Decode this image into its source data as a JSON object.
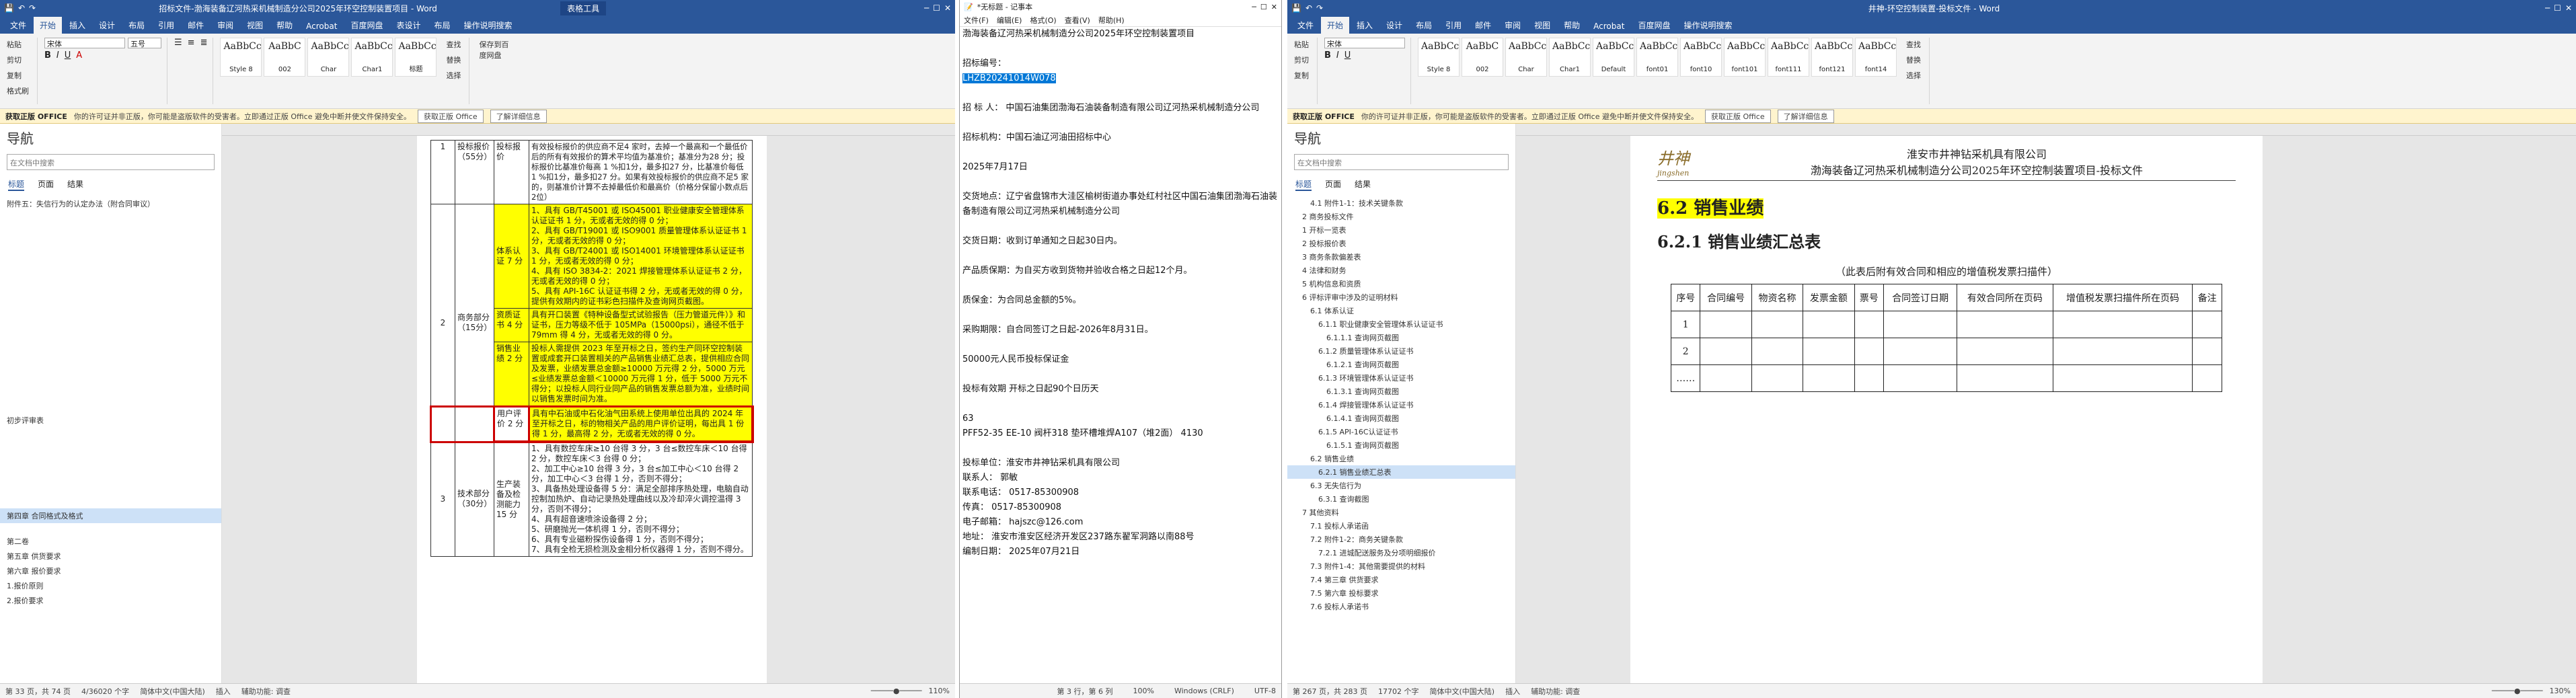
{
  "win1": {
    "title": "招标文件-渤海装备辽河热采机械制造分公司2025年环空控制装置项目 - Word",
    "ctx_tab": "表格工具",
    "share": "共享",
    "tabs": [
      "文件",
      "开始",
      "插入",
      "设计",
      "布局",
      "引用",
      "邮件",
      "审阅",
      "视图",
      "帮助",
      "Acrobat",
      "百度网盘",
      "表设计",
      "布局",
      "操作说明搜索"
    ],
    "ribbon": {
      "paste": "粘贴",
      "cut": "剪切",
      "copy": "复制",
      "format": "格式刷",
      "font": "宋体",
      "size": "五号",
      "find": "查找",
      "replace": "替换",
      "select": "选择",
      "save": "保存到百度网盘"
    },
    "styles": [
      {
        "s": "AaBbCcI",
        "n": "Style 8"
      },
      {
        "s": "AaBbC",
        "n": "002"
      },
      {
        "s": "AaBbCcI",
        "n": "Char"
      },
      {
        "s": "AaBbCcDc",
        "n": "Char1"
      },
      {
        "s": "AaBbCcDc",
        "n": "标题"
      }
    ],
    "msg": {
      "label": "获取正版 OFFICE",
      "text": "你的许可证并非正版，你可能是盗版软件的受害者。立即通过正版 Office 避免中断并使文件保持安全。",
      "b1": "获取正版 Office",
      "b2": "了解详细信息"
    },
    "nav": {
      "title": "导航",
      "search": "在文档中搜索",
      "tabs": [
        "标题",
        "页面",
        "结果"
      ],
      "items": [
        "附件五：失信行为的认定办法（附合同审议）",
        "初步评审表",
        "第四章 合同格式及格式",
        "第二卷",
        "第五章 供货要求",
        "第六章 报价要求",
        "1.报价原则",
        "2.报价要求"
      ]
    },
    "table": {
      "r1_no": "1",
      "r1_name": "投标报价（55分）",
      "r1_sub": "投标报价",
      "r1_text": "有效投标报价的供应商不足4 家时，去掉一个最高和一个最低价后的所有有效报价的算术平均值为基准价；基准分为28 分；投标报价比基准价每高 1 %扣1分，最多扣27 分，比基准价每低 1 %扣1分，最多扣27 分。如果有效投标报价的供应商不足5 家的，则基准价计算不去掉最低价和最高价（价格分保留小数点后2位）",
      "r2_no": "2",
      "r2_name": "商务部分（15分）",
      "sys_label": "体系认证 7 分",
      "sys_items": [
        "1、具有 GB/T45001 或 ISO45001 职业健康安全管理体系认证证书 1 分，无或者无效的得 0 分；",
        "2、具有 GB/T19001 或 ISO9001 质量管理体系认证证书 1 分，无或者无效的得 0 分；",
        "3、具有 GB/T24001 或 ISO14001 环境管理体系认证证书 1 分，无或者无效的得 0 分；",
        "4、具有 ISO 3834-2：2021 焊接管理体系认证证书 2 分，无或者无效的得 0 分；",
        "5、具有 API-16C 认证证书得 2 分，无或者无效的得 0 分，提供有效期内的证书彩色扫描件及查询网页截图。"
      ],
      "cert_label": "资质证书 4 分",
      "cert_text": "具有开口装置《特种设备型式试验报告（压力管道元件）》和证书，压力等级不低于 105MPa（15000psi），通径不低于 79mm 得 4 分，无或者无效的得 0 分。",
      "sales_label": "销售业绩 2 分",
      "sales_text": "投标人需提供 2023 年至开标之日，签约生产同环空控制装置或成套开口装置相关的产品销售业绩汇总表，提供相应合同及发票，业绩发票总金额≥10000 万元得 2 分，5000 万元≤业绩发票总金额＜10000 万元得 1 分，低于 5000 万元不得分；以投标人同行业同产品的销售发票总额为准，业绩时间以销售发票时间为准。",
      "user_label": "用户评价 2 分",
      "user_text": "具有中石油或中石化油气田系统上使用单位出具的 2024 年至开标之日，标的物相关产品的用户评价证明，每出具 1 份得 1 分，最高得 2 分，无或者无效的得 0 分。",
      "r3_no": "3",
      "r3_name": "技术部分（30分）",
      "r3_sub": "生产装备及检测能力 15 分",
      "r3_items": [
        "1、具有数控车床≥10 台得 3 分，3 台≤数控车床＜10 台得 2 分，数控车床＜3 台得 0 分；",
        "2、加工中心≥10 台得 3 分，3 台≤加工中心＜10 台得 2 分，加工中心＜3 台得 1 分，否则不得分；",
        "3、具备热处理设备得 5 分：满足全部排序热处理，电脑自动控制加热炉、自动记录热处理曲线以及冷却淬火调控温得 3 分，否则不得分；",
        "4、具有超音速喷涂设备得 2 分；",
        "5、研磨抛光一体机得 1 分，否则不得分；",
        "6、具有专业磁粉探伤设备得 1 分，否则不得分；",
        "7、具有全检无损检测及金相分析仪器得 1 分，否则不得分。"
      ]
    },
    "status": {
      "page": "第 33 页，共 74 页",
      "words": "4/36020 个字",
      "lang": "简体中文(中国大陆)",
      "ins": "插入",
      "access": "辅助功能: 调查",
      "zoom": "110%"
    }
  },
  "win2": {
    "title": "*无标题 - 记事本",
    "menu": [
      "文件(F)",
      "编辑(E)",
      "格式(O)",
      "查看(V)",
      "帮助(H)"
    ],
    "lines": [
      "渤海装备辽河热采机械制造分公司2025年环空控制装置项目",
      "",
      "招标编号：",
      "LHZB20241014W078",
      "",
      "招 标 人： 中国石油集团渤海石油装备制造有限公司辽河热采机械制造分公司",
      "",
      "招标机构：中国石油辽河油田招标中心",
      "",
      "2025年7月17日",
      "",
      "交货地点：辽宁省盘锦市大洼区榆树街道办事处红村社区中国石油集团渤海石油装备制造有限公司辽河热采机械制造分公司",
      "",
      "交货日期：收到订单通知之日起30日内。",
      "",
      "产品质保期：为自买方收到货物并验收合格之日起12个月。",
      "",
      "质保金：为合同总金额的5%。",
      "",
      "采购期限：自合同签订之日起-2026年8月31日。",
      "",
      "50000元人民币投标保证金",
      "",
      "投标有效期  开标之日起90个日历天",
      "",
      "63",
      "PFF52-35 EE-10 阀杆318 垫环槽堆焊A107（堆2面）  4130",
      "",
      "投标单位：淮安市井神钻采机具有限公司",
      "联系人：  郭敏",
      "联系电话：  0517-85300908",
      "传真：  0517-85300908",
      "电子邮箱：  hajszc@126.com",
      "地址：  淮安市淮安区经济开发区237路东翟军洞路以南88号",
      "编制日期：  2025年07月21日"
    ],
    "status": {
      "pos": "第 3 行，第 6 列",
      "zoom": "100%",
      "eol": "Windows (CRLF)",
      "enc": "UTF-8"
    }
  },
  "win3": {
    "title": "井神-环空控制装置-投标文件 - Word",
    "share": "共享",
    "tabs": [
      "文件",
      "开始",
      "插入",
      "设计",
      "布局",
      "引用",
      "邮件",
      "审阅",
      "视图",
      "帮助",
      "Acrobat",
      "百度网盘",
      "操作说明搜索"
    ],
    "styles": [
      {
        "s": "AaBbCcI",
        "n": "Style 8"
      },
      {
        "s": "AaBbC",
        "n": "002"
      },
      {
        "s": "AaBbCcI",
        "n": "Char"
      },
      {
        "s": "AaBbCcDc",
        "n": "Char1"
      },
      {
        "s": "AaBbCcDc",
        "n": "Default"
      },
      {
        "s": "AaBbCcD",
        "n": "font01"
      },
      {
        "s": "AaBbCcDc",
        "n": "font10"
      },
      {
        "s": "AaBbCcDc",
        "n": "font101"
      },
      {
        "s": "AaBbCcDc",
        "n": "font111"
      },
      {
        "s": "AaBbCcDc",
        "n": "font121"
      },
      {
        "s": "AaBbCcDc",
        "n": "font14"
      }
    ],
    "msg": {
      "label": "获取正版 OFFICE",
      "text": "你的许可证并非正版，你可能是盗版软件的受害者。立即通过正版 Office 避免中断并使文件保持安全。",
      "b1": "获取正版 Office",
      "b2": "了解详细信息"
    },
    "nav": {
      "title": "导航",
      "search": "在文档中搜索",
      "tabs": [
        "标题",
        "页面",
        "结果"
      ],
      "items": [
        "4.1 附件1-1：技术关键条款",
        "2 商务投标文件",
        "1 开标一览表",
        "2 投标报价表",
        "3 商务条款偏差表",
        "4 法律和财务",
        "5 机构信息和资质",
        "6 评标评审中涉及的证明材料",
        "6.1 体系认证",
        "6.1.1 职业健康安全管理体系认证证书",
        "6.1.1.1 查询网页截图",
        "6.1.2 质量管理体系认证证书",
        "6.1.2.1 查询网页截图",
        "6.1.3 环境管理体系认证证书",
        "6.1.3.1 查询网页截图",
        "6.1.4 焊接管理体系认证证书",
        "6.1.4.1 查询网页截图",
        "6.1.5 API-16C认证证书",
        "6.1.5.1 查询网页截图",
        "6.2 销售业绩",
        "6.2.1 销售业绩汇总表",
        "6.3 无失信行为",
        "6.3.1 查询截图",
        "7 其他资料",
        "7.1 投标人承诺函",
        "7.2 附件1-2：商务关键条款",
        "7.2.1 进城配送服务及分项明细报价",
        "7.3 附件1-4：其他需要提供的材料",
        "7.4 第三章 供货要求",
        "7.5 第六章 投标要求",
        "7.6 投标人承诺书"
      ]
    },
    "page": {
      "logo": "井神",
      "logo_sub": "jingshen",
      "hdr_company": "淮安市井神钻采机具有限公司",
      "hdr_project": "渤海装备辽河热采机械制造分公司2025年环空控制装置项目-投标文件",
      "h1": "6.2 销售业绩",
      "h2": "6.2.1 销售业绩汇总表",
      "note": "（此表后附有效合同和相应的增值税发票扫描件）",
      "cols": [
        "序号",
        "合同编号",
        "物资名称",
        "发票金额",
        "票号",
        "合同签订日期",
        "有效合同所在页码",
        "增值税发票扫描件所在页码",
        "备注"
      ],
      "rows": [
        "1",
        "2",
        "……"
      ]
    },
    "status": {
      "page": "第 267 页，共 283 页",
      "words": "17702 个字",
      "lang": "简体中文(中国大陆)",
      "ins": "插入",
      "access": "辅助功能: 调查",
      "zoom": "130%"
    }
  }
}
